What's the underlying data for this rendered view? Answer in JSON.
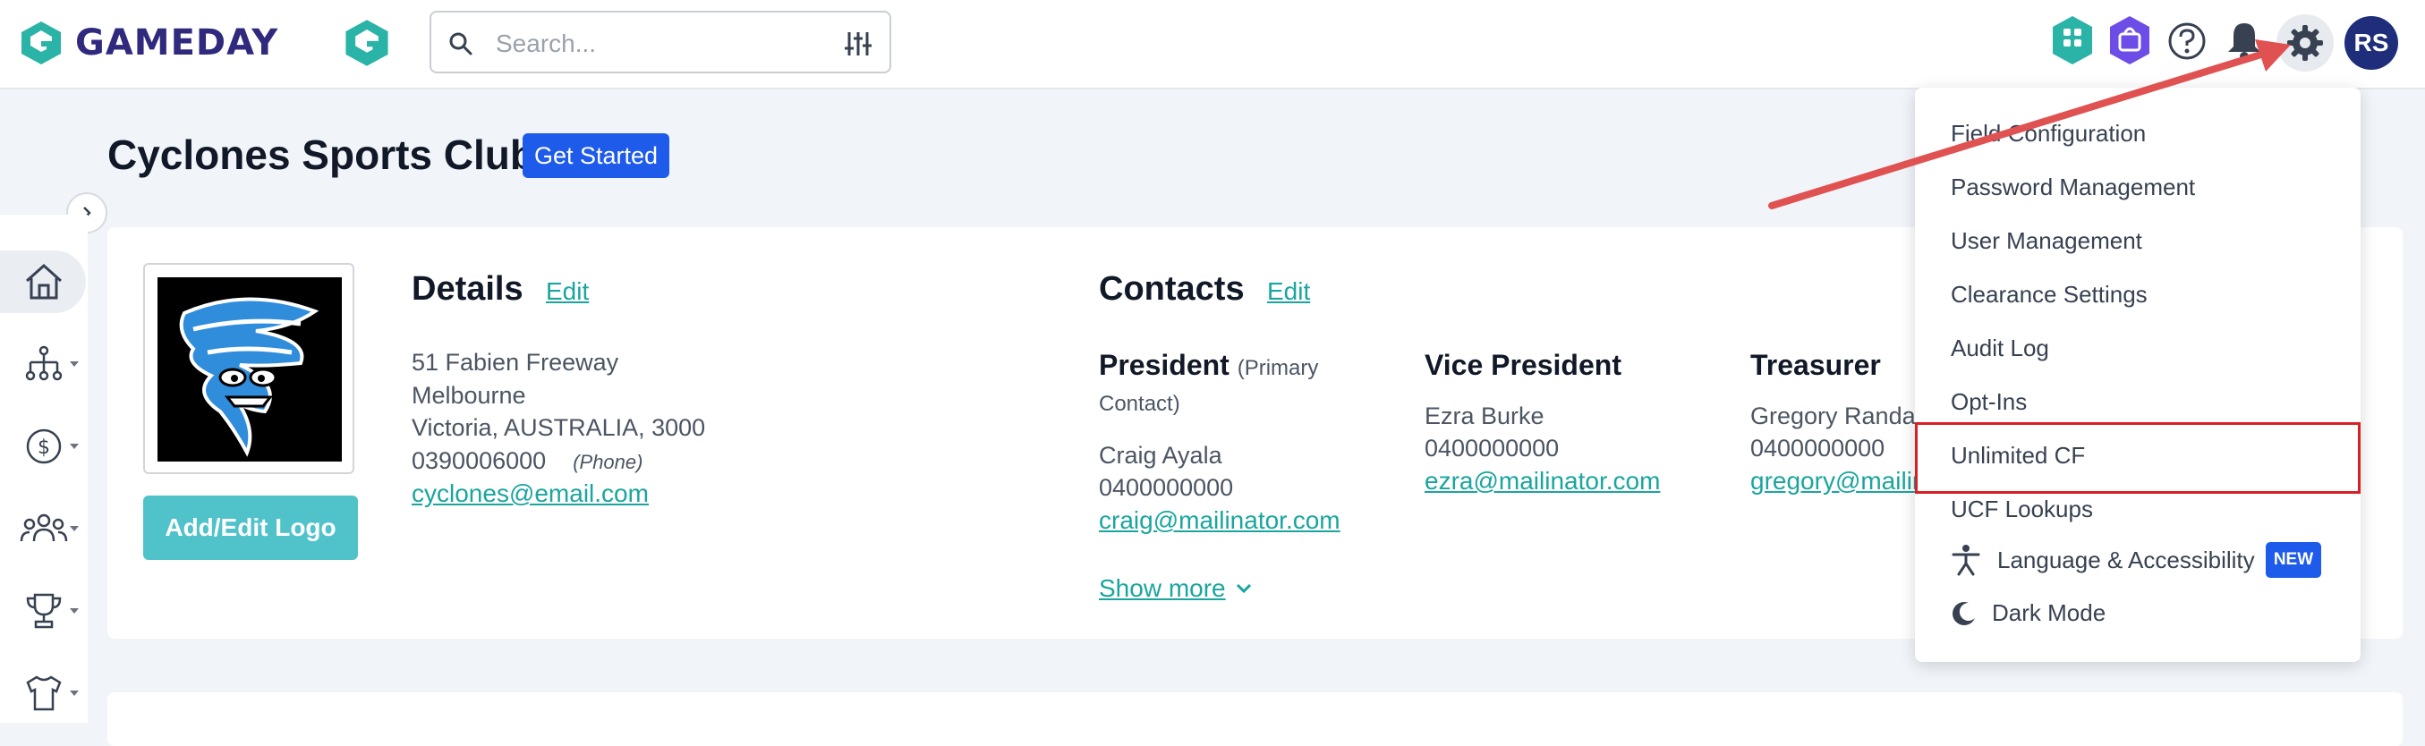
{
  "brand": {
    "name": "GAMEDAY"
  },
  "search": {
    "placeholder": "Search..."
  },
  "header": {
    "avatar_initials": "RS"
  },
  "page": {
    "title": "Cyclones Sports Club",
    "get_started_label": "Get Started"
  },
  "details": {
    "title": "Details",
    "edit_label": "Edit",
    "address_line1": "51 Fabien Freeway",
    "address_line2": "Melbourne",
    "address_line3": "Victoria,  AUSTRALIA,  3000",
    "phone": "0390006000",
    "phone_label": "(Phone)",
    "email": "cyclones@email.com"
  },
  "logo": {
    "add_edit_label": "Add/Edit Logo"
  },
  "contacts": {
    "title": "Contacts",
    "edit_label": "Edit",
    "show_more_label": "Show more",
    "people": [
      {
        "role": "President",
        "role_note": "(Primary",
        "role_note2": "Contact)",
        "name": "Craig Ayala",
        "phone": "0400000000",
        "email": "craig@mailinator.com"
      },
      {
        "role": "Vice President",
        "name": "Ezra Burke",
        "phone": "0400000000",
        "email": "ezra@mailinator.com"
      },
      {
        "role": "Treasurer",
        "name": "Gregory Randal",
        "phone": "0400000000",
        "email": "gregory@mailin"
      }
    ]
  },
  "settings_menu": {
    "items": [
      "Field Configuration",
      "Password Management",
      "User Management",
      "Clearance Settings",
      "Audit Log",
      "Opt-Ins",
      "Unlimited CF",
      "UCF Lookups"
    ],
    "language_label": "Language & Accessibility",
    "new_badge": "NEW",
    "dark_mode_label": "Dark Mode"
  },
  "colors": {
    "accent": "#1aa59e",
    "primary": "#1e5bea",
    "brand": "#2f2a7d",
    "highlight": "#d91f26"
  }
}
